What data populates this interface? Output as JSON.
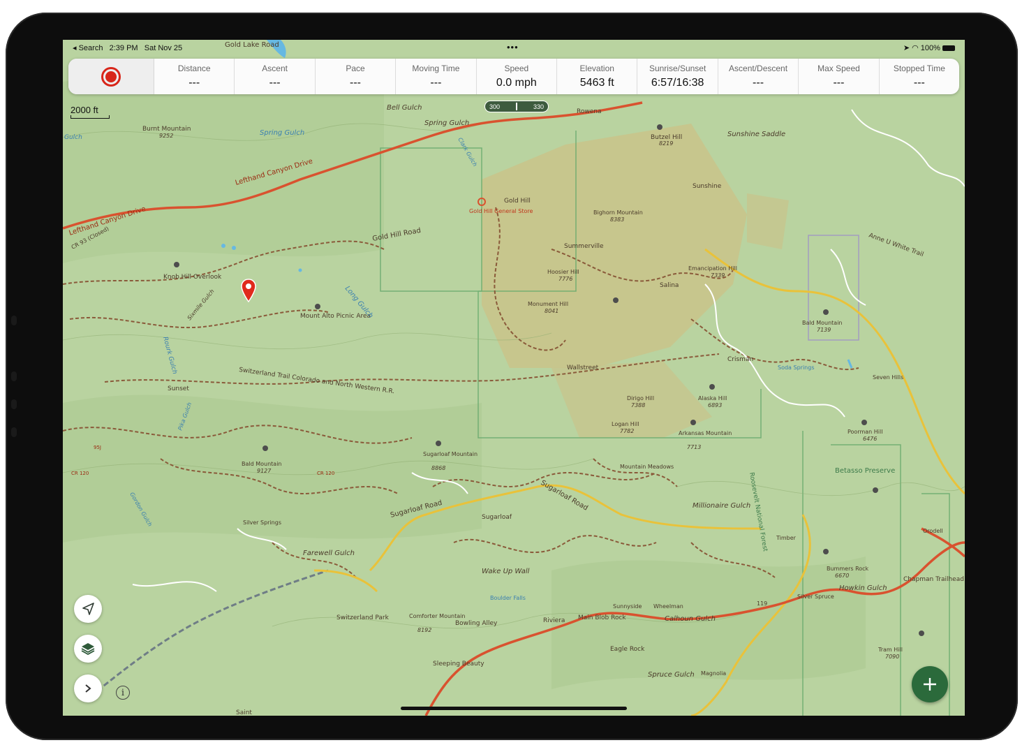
{
  "status_bar": {
    "back_app": "◂ Search",
    "time": "2:39 PM",
    "date": "Sat Nov 25",
    "battery": "100%"
  },
  "stats": [
    {
      "label": "Distance",
      "value": "---"
    },
    {
      "label": "Ascent",
      "value": "---"
    },
    {
      "label": "Pace",
      "value": "---"
    },
    {
      "label": "Moving Time",
      "value": "---"
    },
    {
      "label": "Speed",
      "value": "0.0 mph"
    },
    {
      "label": "Elevation",
      "value": "5463 ft"
    },
    {
      "label": "Sunrise/Sunset",
      "value": "6:57/16:38"
    },
    {
      "label": "Ascent/Descent",
      "value": "---"
    },
    {
      "label": "Max Speed",
      "value": "---"
    },
    {
      "label": "Stopped Time",
      "value": "---"
    }
  ],
  "scale": "2000 ft",
  "zoom": {
    "left": "300",
    "right": "330"
  },
  "colors": {
    "record": "#d8261a",
    "fab": "#2b6a3b",
    "land": "#b9d3a0",
    "public_land": "#c9c38a",
    "road_major": "#d9522f",
    "road_yellow": "#e9c23a",
    "trail": "#8a5a3a"
  },
  "map_labels": {
    "gold_lake_road": "Gold Lake Road",
    "bell_gulch": "Bell Gulch",
    "spring_gulch": "Spring Gulch",
    "spring_gulch2": "Spring Gulch",
    "burnt_mountain": "Burnt Mountain",
    "burnt_mountain_elev": "9252",
    "lefthand_canyon_drive": "Lefthand Canyon Drive",
    "lefthand_canyon_drive2": "Lefthand Canyon Drive",
    "rowena": "Rowena",
    "butzel_hill": "Butzel Hill",
    "butzel_hill_elev": "8219",
    "sunshine_saddle": "Sunshine Saddle",
    "sunshine": "Sunshine",
    "gold_hill": "Gold Hill",
    "gold_hill_store": "Gold Hill General Store",
    "gold_hill_road": "Gold Hill Road",
    "bighorn_mountain": "Bighorn Mountain",
    "bighorn_mountain_elev": "8383",
    "summerville": "Summerville",
    "hoosier_hill": "Hoosier Hill",
    "hoosier_hill_elev": "7776",
    "monument_hill": "Monument Hill",
    "monument_hill_elev": "8041",
    "emancipation_hill": "Emancipation Hill",
    "emancipation_hill_elev": "7339",
    "salina": "Salina",
    "anne_white_trail": "Anne U White Trail",
    "bald_mountain_e": "Bald Mountain",
    "bald_mountain_e_elev": "7139",
    "knob_hill_overlook": "Knob Hill Overlook",
    "cr93": "CR 93 (Closed)",
    "mount_alto": "Mount Alto Picnic Area",
    "long_gulch": "Long Gulch",
    "switzerland_trail": "Switzerland Trail Colorado and North Western R.R.",
    "sunset": "Sunset",
    "wallstreet": "Wallstreet",
    "crisman": "Crisman",
    "soda_springs": "Soda Springs",
    "seven_hills": "Seven Hills",
    "alaska_hill": "Alaska Hill",
    "alaska_hill_elev": "6893",
    "dirigo_hill": "Dirigo Hill",
    "dirigo_hill_elev": "7388",
    "logan_hill": "Logan Hill",
    "logan_hill_elev": "7782",
    "arkansas_mountain": "Arkansas Mountain",
    "arkansas_mountain_elev": "7713",
    "poorman_hill": "Poorman Hill",
    "poorman_hill_elev": "6476",
    "betasso_preserve": "Betasso Preserve",
    "bald_mountain_w": "Bald Mountain",
    "bald_mountain_w_elev": "9127",
    "sugarloaf_mountain": "Sugarloaf Mountain",
    "sugarloaf_mountain_elev": "8868",
    "mountain_meadows": "Mountain Meadows",
    "sugarloaf_road": "Sugarloaf Road",
    "sugarloaf_road2": "Sugarloaf Road",
    "sugarloaf": "Sugarloaf",
    "millionaire_gulch": "Millionaire Gulch",
    "roosevelt_forest": "Roosevelt National Forest",
    "silver_springs": "Silver Springs",
    "farewell_gulch": "Farewell Gulch",
    "wake_up_wall": "Wake Up Wall",
    "boulder_falls": "Boulder Falls",
    "switzerland_park": "Switzerland Park",
    "comforter_mountain": "Comforter Mountain",
    "comforter_mountain_elev": "8192",
    "bowling_alley": "Bowling Alley",
    "riviera": "Riviera",
    "main_blob_rock": "Main Blob Rock",
    "sunnyside": "Sunnyside",
    "wheelman": "Wheelman",
    "calhoun_gulch": "Calhoun Gulch",
    "eagle_rock": "Eagle Rock",
    "sleeping_beauty": "Sleeping Beauty",
    "spruce_gulch": "Spruce Gulch",
    "magnolia": "Magnolia",
    "bummers_rock": "Bummers Rock",
    "bummers_rock_elev": "6670",
    "howkin_gulch": "Howkin Gulch",
    "chapman_trailhead": "Chapman Trailhead",
    "silver_spruce": "Silver Spruce",
    "tram_hill": "Tram Hill",
    "tram_hill_elev": "7090",
    "orodell": "Orodell",
    "road_119": "119",
    "cr120_a": "CR 120",
    "cr120_b": "CR 120",
    "road_95": "95J",
    "saint": "Saint",
    "rourk_gulch": "Rourk Gulch",
    "pika_gulch": "Pika Gulch",
    "gordon_gulch": "Gordon Gulch",
    "sixmile_gulch": "Sixmile Gulch",
    "gulch_w": "Gulch",
    "timber": "Timber",
    "clark_gulch": "Clark Gulch"
  },
  "controls": {
    "locate": "locate-arrow-icon",
    "layers": "layers-icon",
    "expand": "chevron-right-icon",
    "info": "i",
    "add": "+"
  }
}
